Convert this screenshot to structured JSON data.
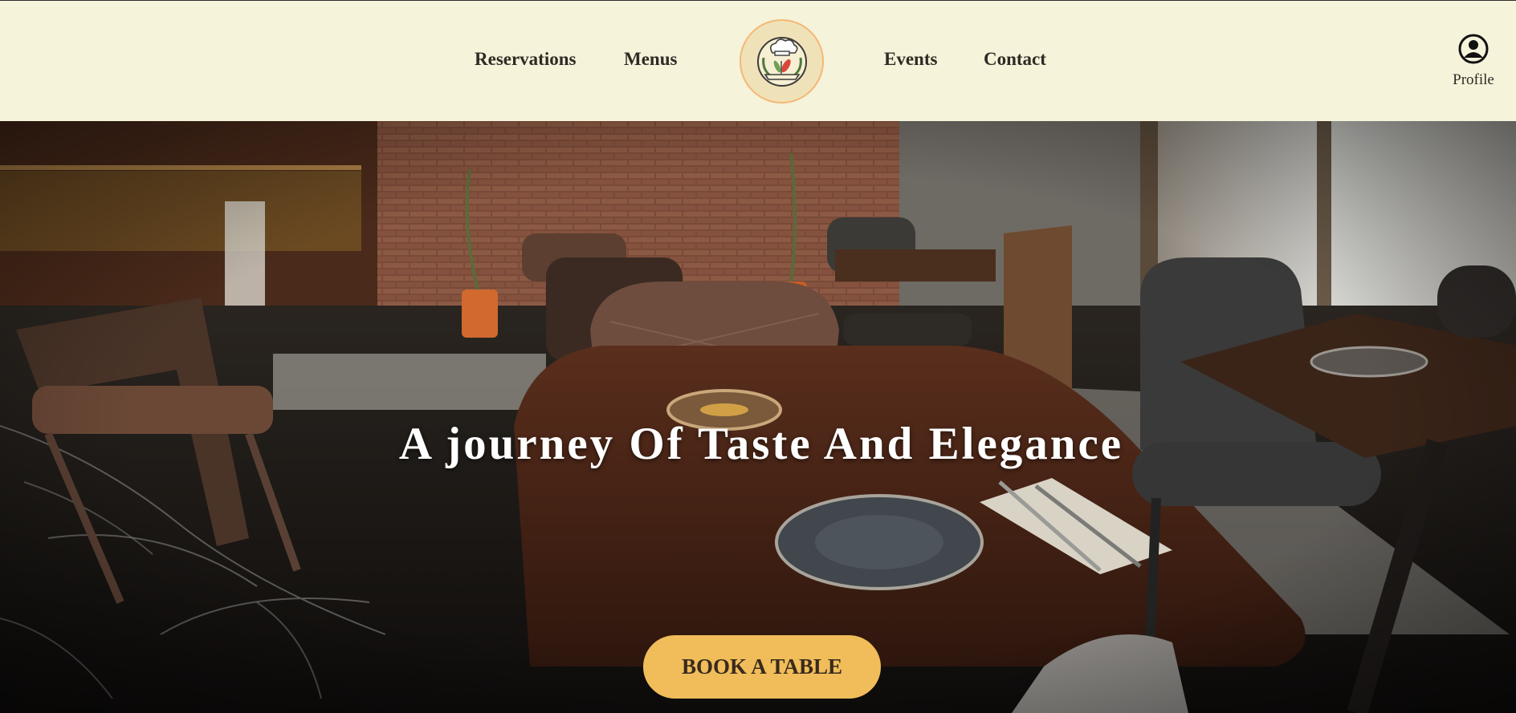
{
  "nav": {
    "left_links": [
      "Reservations",
      "Menus"
    ],
    "right_links": [
      "Events",
      "Contact"
    ],
    "logo_icon": "chef-hat-logo-icon"
  },
  "profile": {
    "label": "Profile",
    "icon": "user-circle-icon"
  },
  "hero": {
    "title": "A journey Of Taste And Elegance",
    "cta_label": "BOOK A TABLE",
    "background": "restaurant-interior-photo"
  },
  "colors": {
    "header_bg": "#f5f3da",
    "nav_text": "#2f2a24",
    "cta_bg": "#f0bd5a",
    "cta_text": "#3a2a1c",
    "logo_ring": "#f3b877"
  }
}
